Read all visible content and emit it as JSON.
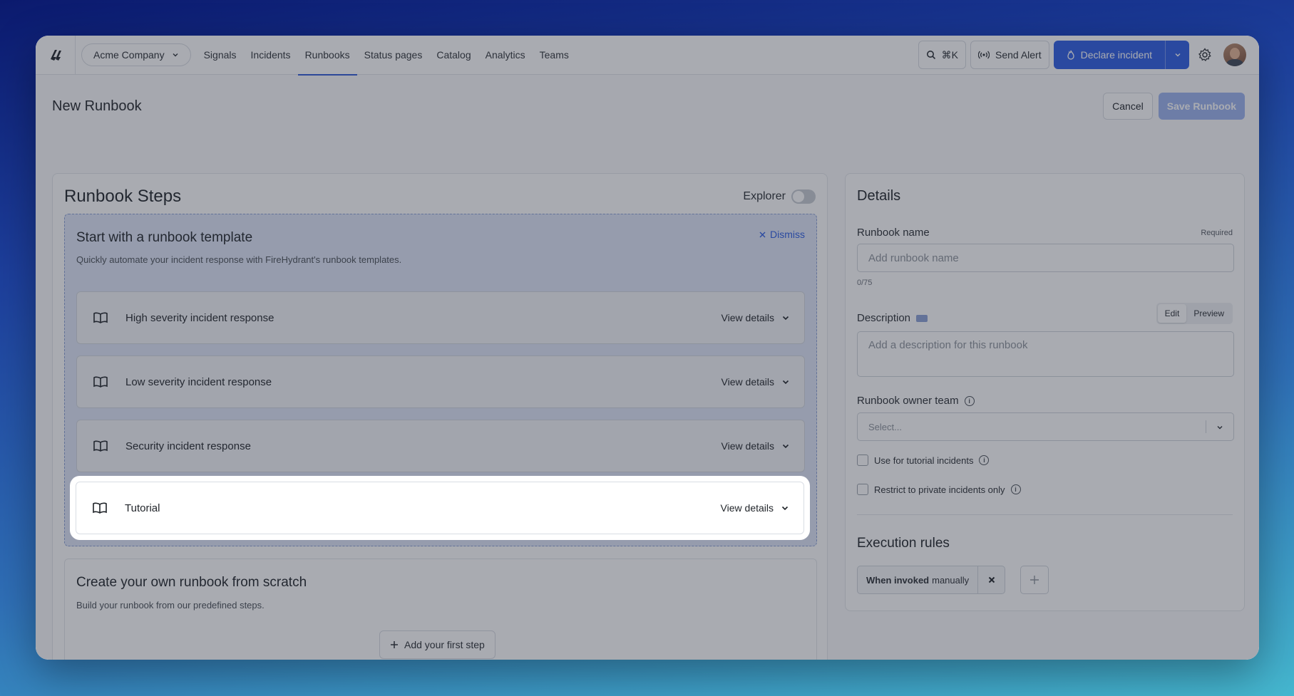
{
  "company": {
    "name": "Acme Company"
  },
  "nav": [
    {
      "label": "Signals"
    },
    {
      "label": "Incidents"
    },
    {
      "label": "Runbooks"
    },
    {
      "label": "Status pages"
    },
    {
      "label": "Catalog"
    },
    {
      "label": "Analytics"
    },
    {
      "label": "Teams"
    }
  ],
  "nav_active": "Runbooks",
  "topbar": {
    "search_shortcut": "⌘K",
    "send_alert": "Send Alert",
    "declare_incident": "Declare incident"
  },
  "page": {
    "title": "New Runbook",
    "cancel": "Cancel",
    "save": "Save Runbook"
  },
  "steps": {
    "title": "Runbook Steps",
    "explorer_label": "Explorer",
    "explorer_on": false,
    "template": {
      "title": "Start with a runbook template",
      "subtitle": "Quickly automate your incident response with FireHydrant's runbook templates.",
      "dismiss": "Dismiss",
      "items": [
        {
          "name": "High severity incident response",
          "action": "View details"
        },
        {
          "name": "Low severity incident response",
          "action": "View details"
        },
        {
          "name": "Security incident response",
          "action": "View details"
        },
        {
          "name": "Tutorial",
          "action": "View details"
        }
      ]
    },
    "scratch": {
      "title": "Create your own runbook from scratch",
      "subtitle": "Build your runbook from our predefined steps.",
      "add_step": "Add your first step"
    }
  },
  "details": {
    "title": "Details",
    "name_label": "Runbook name",
    "required": "Required",
    "name_placeholder": "Add runbook name",
    "counter": "0/75",
    "description_label": "Description",
    "edit_tab": "Edit",
    "preview_tab": "Preview",
    "description_placeholder": "Add a description for this runbook",
    "owner_label": "Runbook owner team",
    "owner_placeholder": "Select...",
    "tutorial_label": "Use for tutorial incidents",
    "private_label": "Restrict to private incidents only",
    "exec_title": "Execution rules",
    "rule_bold": "When invoked",
    "rule_rest": "manually"
  },
  "colors": {
    "accent": "#2c5de3",
    "save_disabled": "#9bb3ef",
    "template_bg": "#dfe7f8"
  }
}
